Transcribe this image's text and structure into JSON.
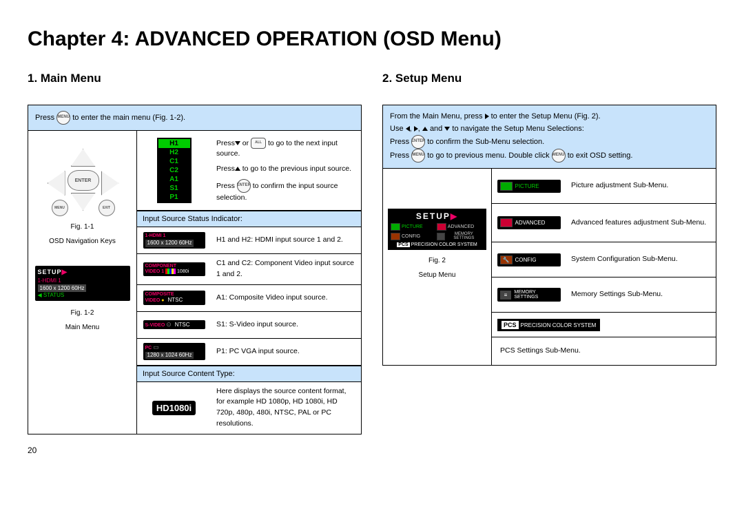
{
  "page_number": "20",
  "chapter_title": "Chapter 4: ADVANCED OPERATION (OSD Menu)",
  "section1": {
    "heading": "1. Main Menu"
  },
  "section2": {
    "heading": "2. Setup Menu"
  },
  "main": {
    "intro_pre": "Press",
    "intro_post": " to enter the main menu (Fig. 1-2).",
    "fig11_a": "Fig. 1-1",
    "fig11_b": "OSD Navigation Keys",
    "fig12_a": "Fig. 1-2",
    "fig12_b": "Main Menu",
    "nav_enter": "ENTER",
    "nav_menu": "MENU",
    "nav_exit": "EXIT",
    "osd": {
      "setup": "SETUP",
      "hdmi": "1-HDMI 1",
      "res": "1600 x 1200 60Hz",
      "status": "STATUS"
    },
    "sources": [
      "H1",
      "H2",
      "C1",
      "C2",
      "A1",
      "S1",
      "P1"
    ],
    "instr1_pre": "Press",
    "instr1_mid": " or ",
    "instr1_post": " to go to the next input source.",
    "instr2_pre": "Press",
    "instr2_post": " to go to the previous input source.",
    "instr3_pre": "Press",
    "instr3_post": " to confirm the input source selection.",
    "enter_label": "ENTER",
    "all_label": "ALL",
    "status_header": "Input Source Status Indicator:",
    "ind_h": {
      "top": "1-HDMI 1",
      "bot": "1600 x 1200 60Hz"
    },
    "desc_h": "H1 and H2: HDMI input source 1 and 2.",
    "ind_c": {
      "top": "COMPONENT",
      "mid": "VIDEO 1",
      "tag": "1080i"
    },
    "desc_c": "C1 and C2: Component Video input source 1 and 2.",
    "ind_a": {
      "top": "COMPOSITE",
      "mid": "VIDEO",
      "tag": "NTSC"
    },
    "desc_a": "A1: Composite Video input source.",
    "ind_s": {
      "top": "S-VIDEO",
      "tag": "NTSC"
    },
    "desc_s": "S1: S-Video input source.",
    "ind_p": {
      "top": "PC",
      "bot": "1280 x 1024 60Hz"
    },
    "desc_p": "P1: PC VGA input source.",
    "content_header": "Input Source Content Type:",
    "hd_badge": "HD1080i",
    "content_desc": "Here displays the source content format, for example HD 1080p, HD 1080i, HD 720p, 480p, 480i, NTSC, PAL or PC resolutions."
  },
  "setup": {
    "intro1_pre": "From the Main Menu, press ",
    "intro1_post": "to enter the Setup Menu (Fig. 2).",
    "intro2_pre": "Use ",
    "intro2_mid": " and ",
    "intro2_post": " to navigate the Setup Menu Selections:",
    "intro3_pre": "Press",
    "intro3_post": " to confirm the Sub-Menu selection.",
    "intro4_pre": "Press",
    "intro4_mid": " to go to previous menu. Double click ",
    "intro4_post": " to exit OSD setting.",
    "enter_label": "ENTER",
    "menu_label": "MENU",
    "fig2_a": "Fig. 2",
    "fig2_b": "Setup Menu",
    "preview": {
      "title": "SETUP",
      "items": [
        "PICTURE",
        "ADVANCED",
        "CONFIG",
        "MEMORY SETTINGS"
      ],
      "pcs": "PRECISION COLOR SYSTEM",
      "pcs_short": "PCS"
    },
    "rows": {
      "picture_label": "PICTURE",
      "picture_desc": "Picture adjustment Sub-Menu.",
      "advanced_label": "ADVANCED",
      "advanced_desc": "Advanced features adjustment Sub-Menu.",
      "config_label": "CONFIG",
      "config_desc": "System Configuration Sub-Menu.",
      "memory_label": "MEMORY SETTINGS",
      "memory_desc": "Memory Settings Sub-Menu.",
      "pcs_short": "PCS",
      "pcs_long": "PRECISION COLOR SYSTEM",
      "pcs_desc": "PCS Settings Sub-Menu."
    }
  }
}
